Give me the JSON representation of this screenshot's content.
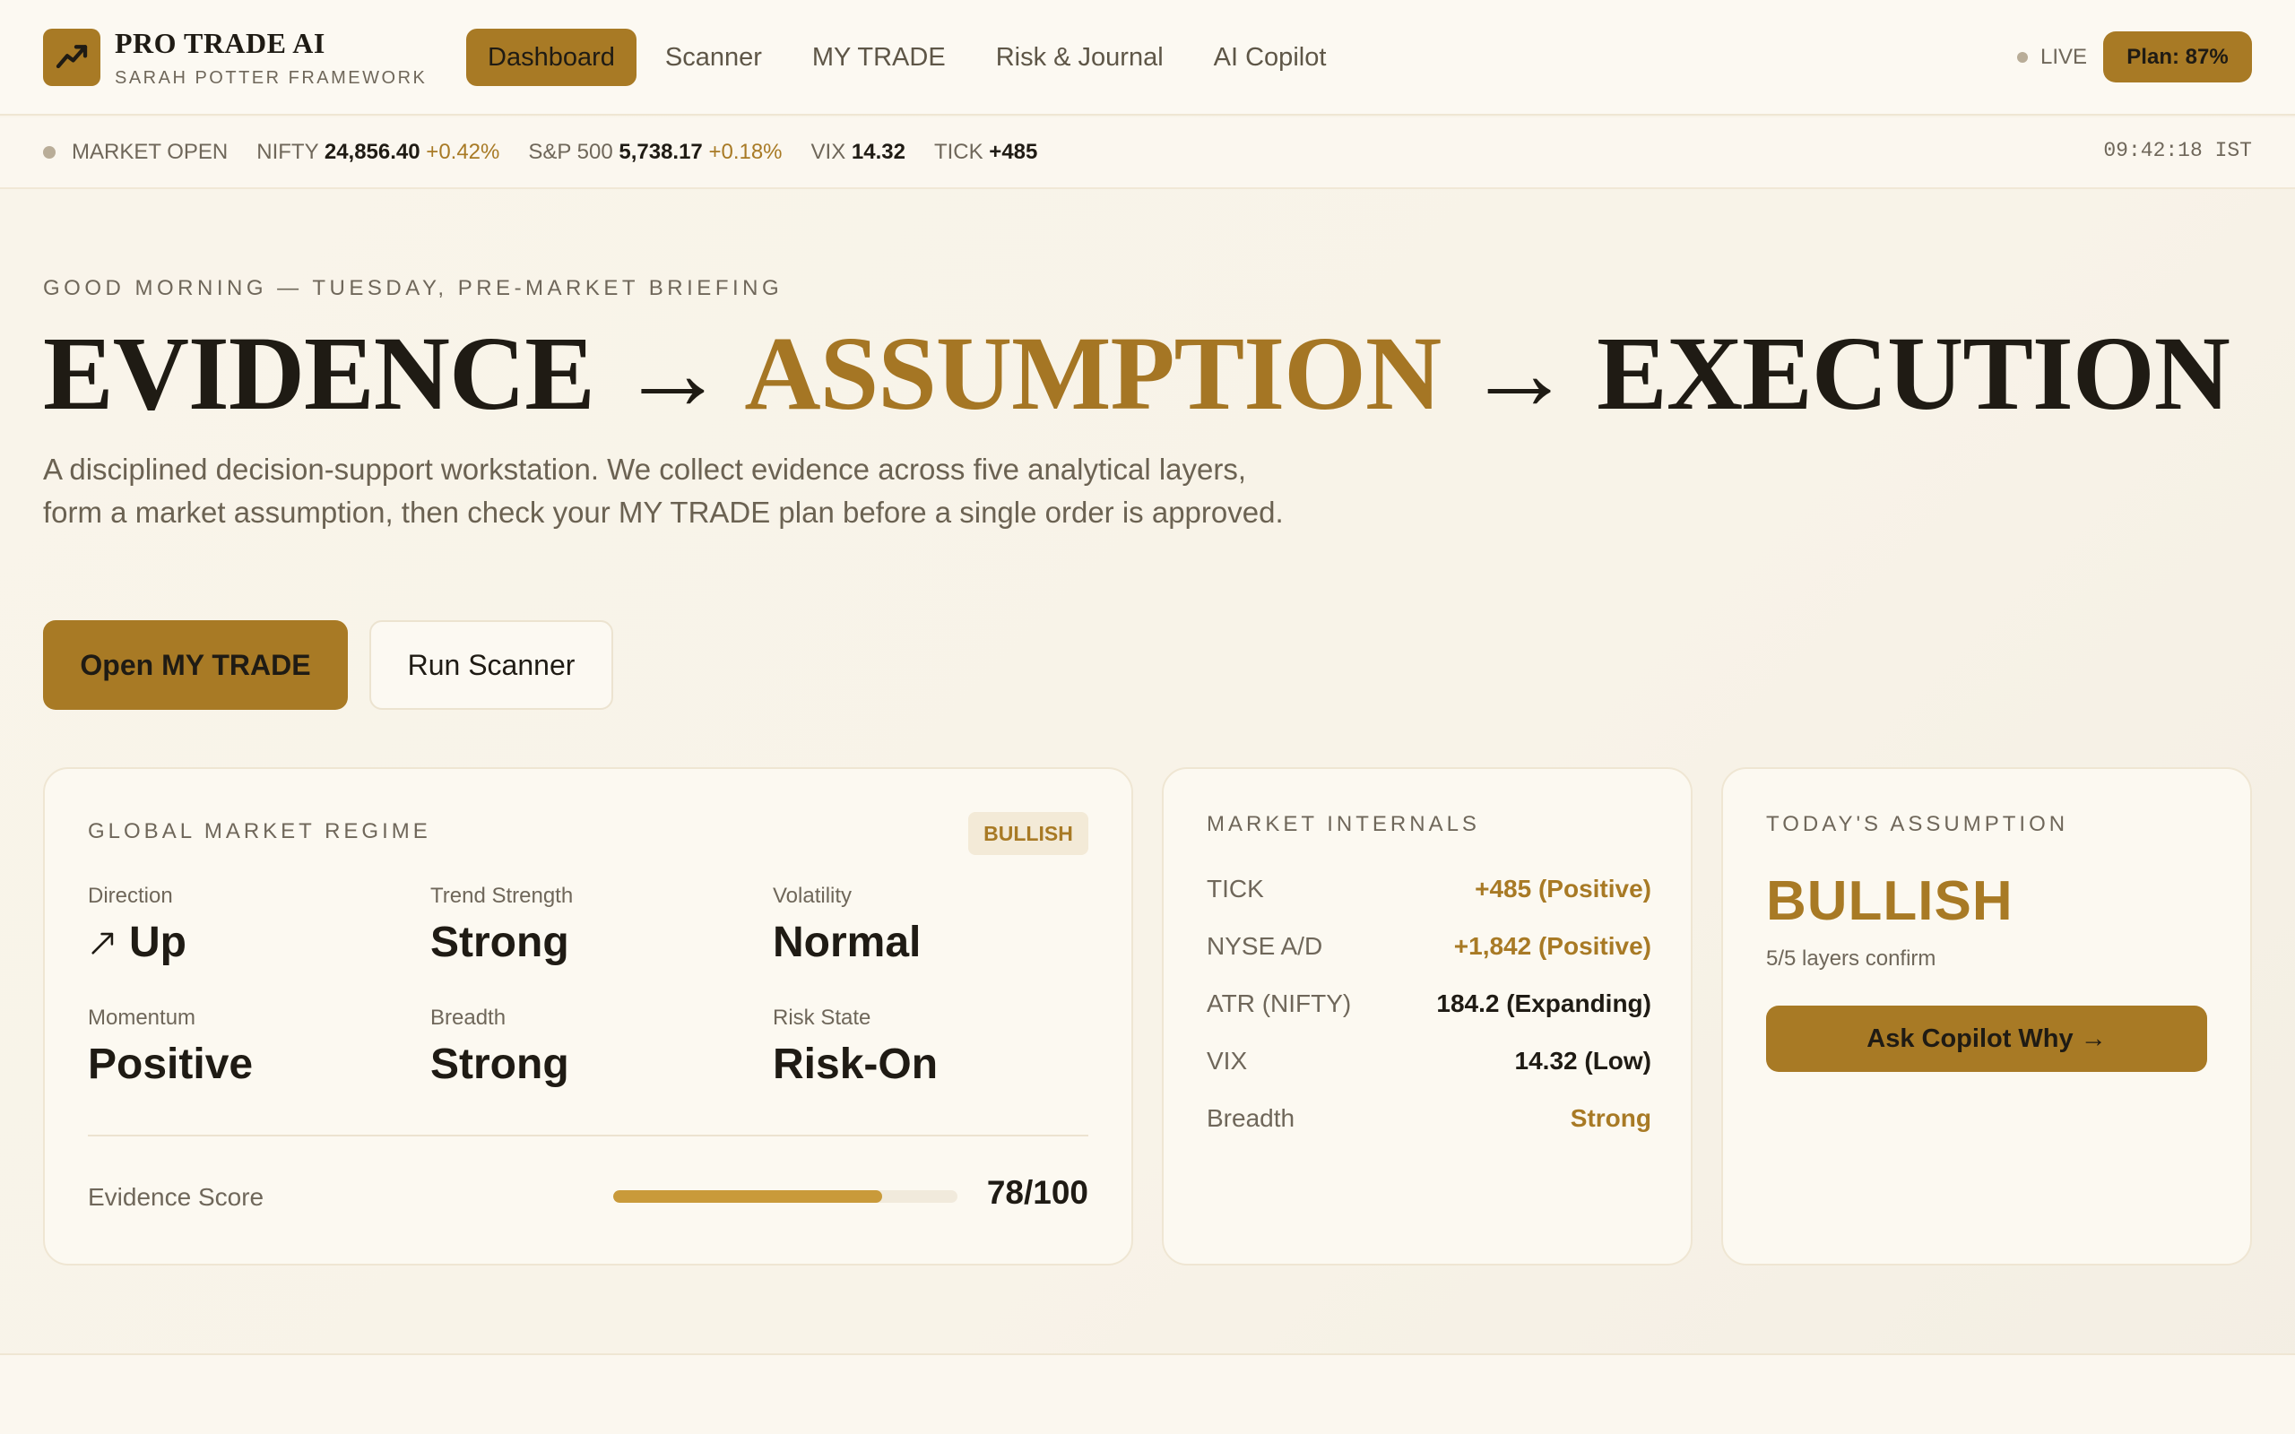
{
  "brand": {
    "title": "PRO TRADE AI",
    "subtitle": "SARAH POTTER FRAMEWORK",
    "logo_icon": "trend-up-icon"
  },
  "nav": {
    "items": [
      {
        "label": "Dashboard",
        "active": true
      },
      {
        "label": "Scanner"
      },
      {
        "label": "MY TRADE"
      },
      {
        "label": "Risk & Journal"
      },
      {
        "label": "AI Copilot"
      }
    ],
    "live_label": "LIVE",
    "plan_label": "Plan: 87%"
  },
  "ticker": {
    "status": "MARKET OPEN",
    "items": [
      {
        "name": "NIFTY",
        "value": "24,856.40",
        "change": "+0.42%"
      },
      {
        "name": "S&P 500",
        "value": "5,738.17",
        "change": "+0.18%"
      },
      {
        "name": "VIX",
        "value": "14.32"
      },
      {
        "name": "TICK",
        "value": "+485"
      }
    ],
    "clock": "09:42:18 IST"
  },
  "hero": {
    "greeting": "GOOD MORNING — TUESDAY, PRE-MARKET BRIEFING",
    "headline": {
      "part1": "EVIDENCE",
      "arrow1": "→",
      "part2": "ASSUMPTION",
      "arrow2": "→",
      "part3": "EXECUTION"
    },
    "lede": "A disciplined decision-support workstation. We collect evidence across five analytical layers, form a market assumption, then check your MY TRADE plan before a single order is approved.",
    "primary_button": "Open MY TRADE",
    "secondary_button": "Run Scanner"
  },
  "regime": {
    "label": "GLOBAL MARKET REGIME",
    "badge": "BULLISH",
    "metrics": [
      {
        "label": "Direction",
        "value": "Up",
        "icon": "arrow-up-right-icon"
      },
      {
        "label": "Trend Strength",
        "value": "Strong"
      },
      {
        "label": "Volatility",
        "value": "Normal"
      },
      {
        "label": "Momentum",
        "value": "Positive"
      },
      {
        "label": "Breadth",
        "value": "Strong"
      },
      {
        "label": "Risk State",
        "value": "Risk-On"
      }
    ],
    "score_label": "Evidence Score",
    "score_value": "78/100",
    "score_fraction": 0.78
  },
  "internals": {
    "label": "MARKET INTERNALS",
    "rows": [
      {
        "key": "TICK",
        "value": "+485 (Positive)",
        "tone": "gold"
      },
      {
        "key": "NYSE A/D",
        "value": "+1,842 (Positive)",
        "tone": "gold"
      },
      {
        "key": "ATR (NIFTY)",
        "value": "184.2 (Expanding)",
        "tone": "dark"
      },
      {
        "key": "VIX",
        "value": "14.32 (Low)",
        "tone": "dark"
      },
      {
        "key": "Breadth",
        "value": "Strong",
        "tone": "gold"
      }
    ]
  },
  "assumption": {
    "label": "TODAY'S ASSUMPTION",
    "value": "BULLISH",
    "sub": "5/5 layers confirm",
    "button": "Ask Copilot Why →"
  },
  "colors": {
    "accent": "#a87a25",
    "background": "#f9f4ea",
    "text": "#1f1b14",
    "muted": "#6f675a"
  }
}
